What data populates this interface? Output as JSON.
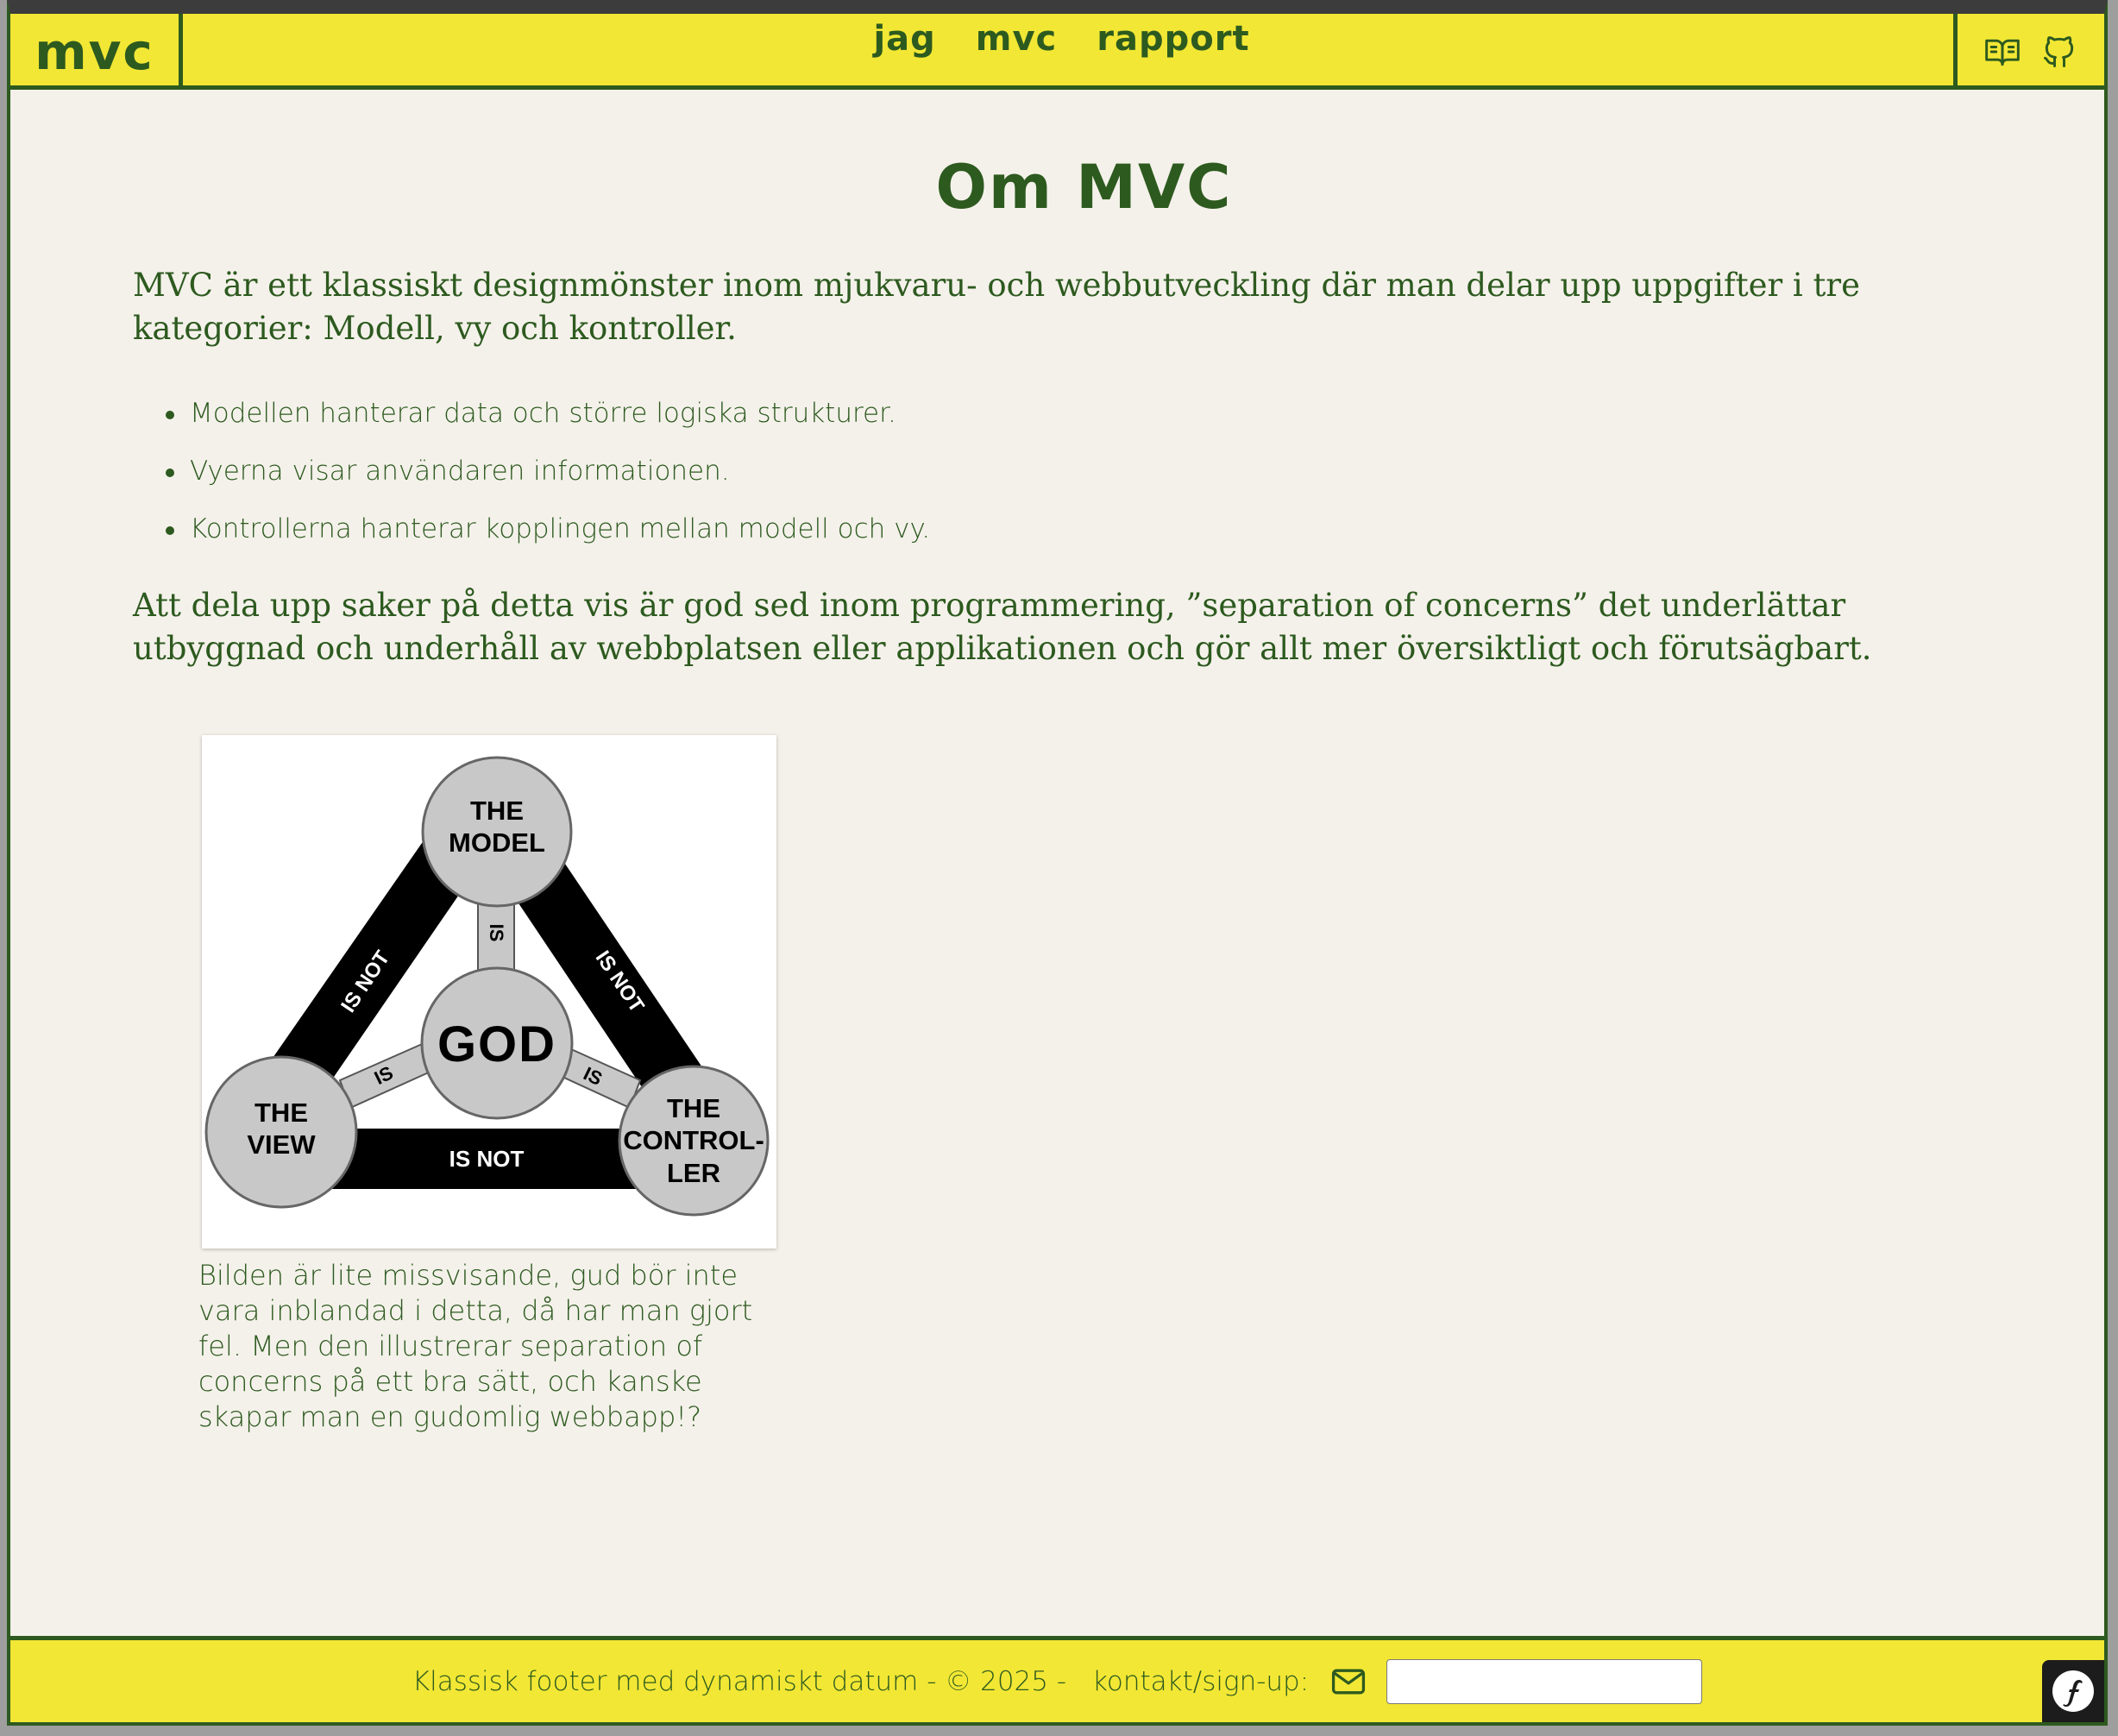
{
  "header": {
    "brand": "mvc",
    "nav": [
      {
        "label": "jag"
      },
      {
        "label": "mvc"
      },
      {
        "label": "rapport"
      }
    ],
    "icons": [
      "book-icon",
      "github-icon"
    ]
  },
  "main": {
    "title": "Om MVC",
    "intro": "MVC är ett klassiskt designmönster inom mjukvaru- och webbutveckling där man delar upp uppgifter i tre kategorier: Modell, vy och kontroller.",
    "bullets": [
      "Modellen hanterar data och större logiska strukturer.",
      "Vyerna visar användaren informationen.",
      "Kontrollerna hanterar kopplingen mellan modell och vy."
    ],
    "outro": "Att dela upp saker på detta vis är god sed inom programmering, ”separation of concerns” det underlättar utbyggnad och underhåll av webbplatsen eller applikationen och gör allt mer översiktligt och förutsägbart.",
    "figure": {
      "nodes": {
        "model": [
          "THE",
          "MODEL"
        ],
        "view": [
          "THE",
          "VIEW"
        ],
        "controller": [
          "THE",
          "CONTROL-",
          "LER"
        ],
        "god": "GOD"
      },
      "edges": {
        "is": "IS",
        "is_not": "IS NOT"
      },
      "caption": "Bilden är lite missvisande, gud bör inte vara inblandad i detta, då har man gjort fel. Men den illustrerar separation of concerns på ett bra sätt, och kanske skapar man en gudomlig webbapp!?"
    }
  },
  "footer": {
    "text": "Klassisk footer med dynamiskt datum - © 2025 -",
    "contact_label": "kontakt/sign-up:",
    "input_value": ""
  },
  "colors": {
    "accent_yellow": "#f2e734",
    "text_green": "#2d5a1f",
    "page_bg": "#f4f1ea"
  }
}
